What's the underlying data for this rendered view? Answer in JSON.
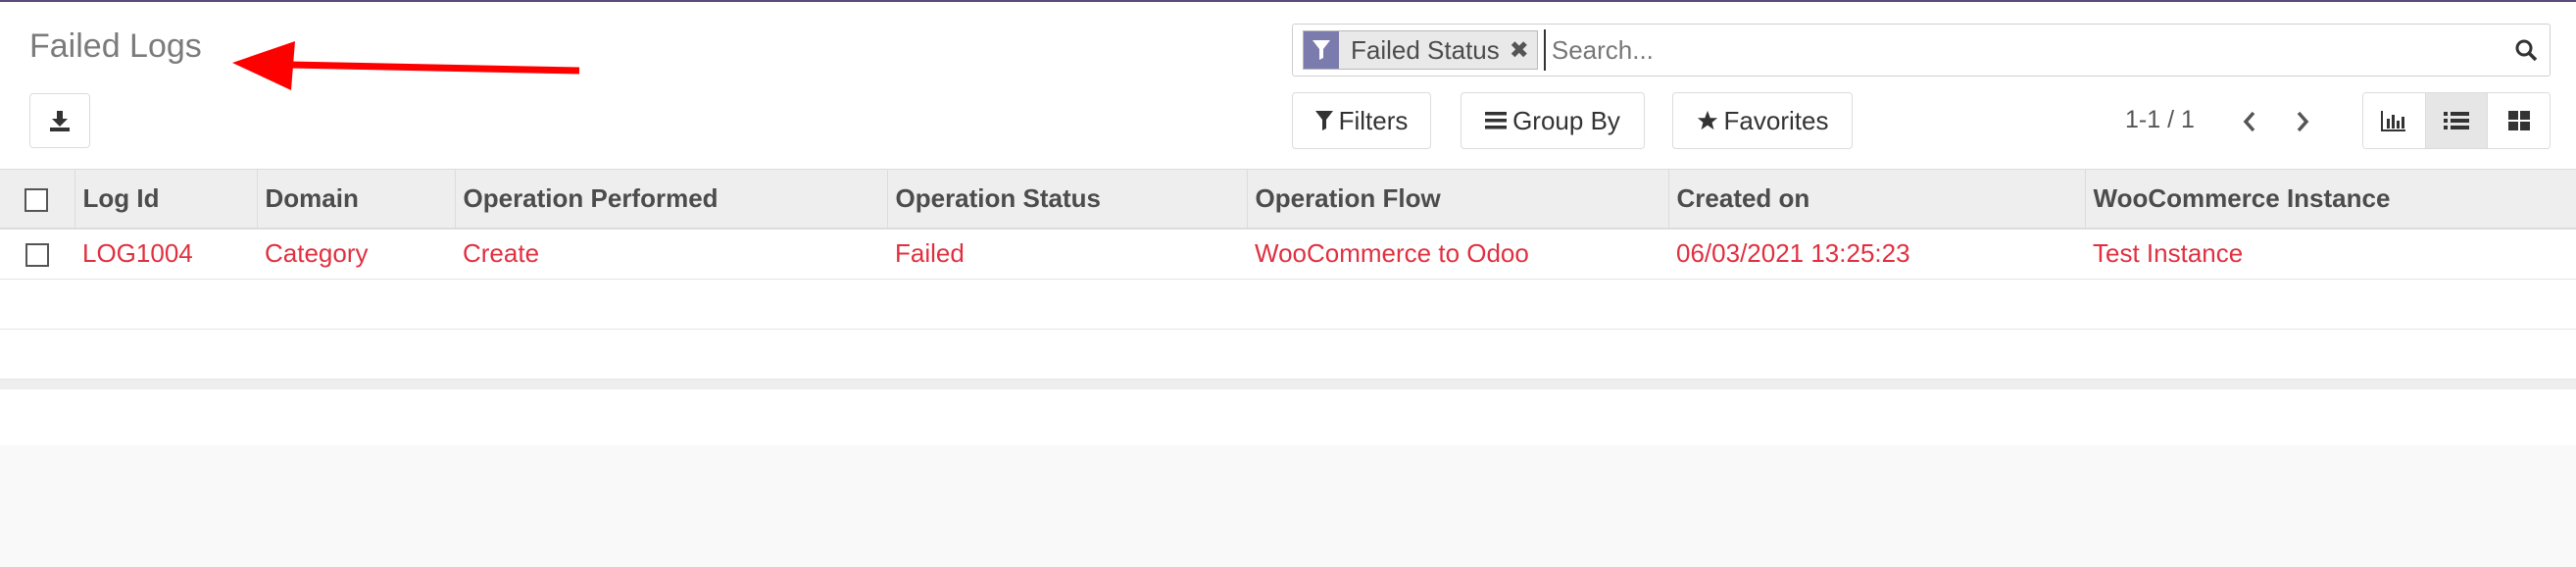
{
  "page": {
    "title": "Failed Logs"
  },
  "search": {
    "facet_label": "Failed Status",
    "facet_remove": "✖",
    "placeholder": "Search..."
  },
  "toolbar": {
    "filters_label": "Filters",
    "groupby_label": "Group By",
    "favorites_label": "Favorites"
  },
  "pager": {
    "value": "1-1 / 1"
  },
  "views": [
    "graph",
    "list",
    "kanban"
  ],
  "active_view": "list",
  "table": {
    "columns": [
      "Log Id",
      "Domain",
      "Operation Performed",
      "Operation Status",
      "Operation Flow",
      "Created on",
      "WooCommerce Instance"
    ],
    "rows": [
      [
        "LOG1004",
        "Category",
        "Create",
        "Failed",
        "WooCommerce to Odoo",
        "06/03/2021 13:25:23",
        "Test Instance"
      ]
    ]
  },
  "colors": {
    "accent": "#7c7bad",
    "row_text": "#e03040",
    "annotation_arrow": "#ff0000"
  }
}
